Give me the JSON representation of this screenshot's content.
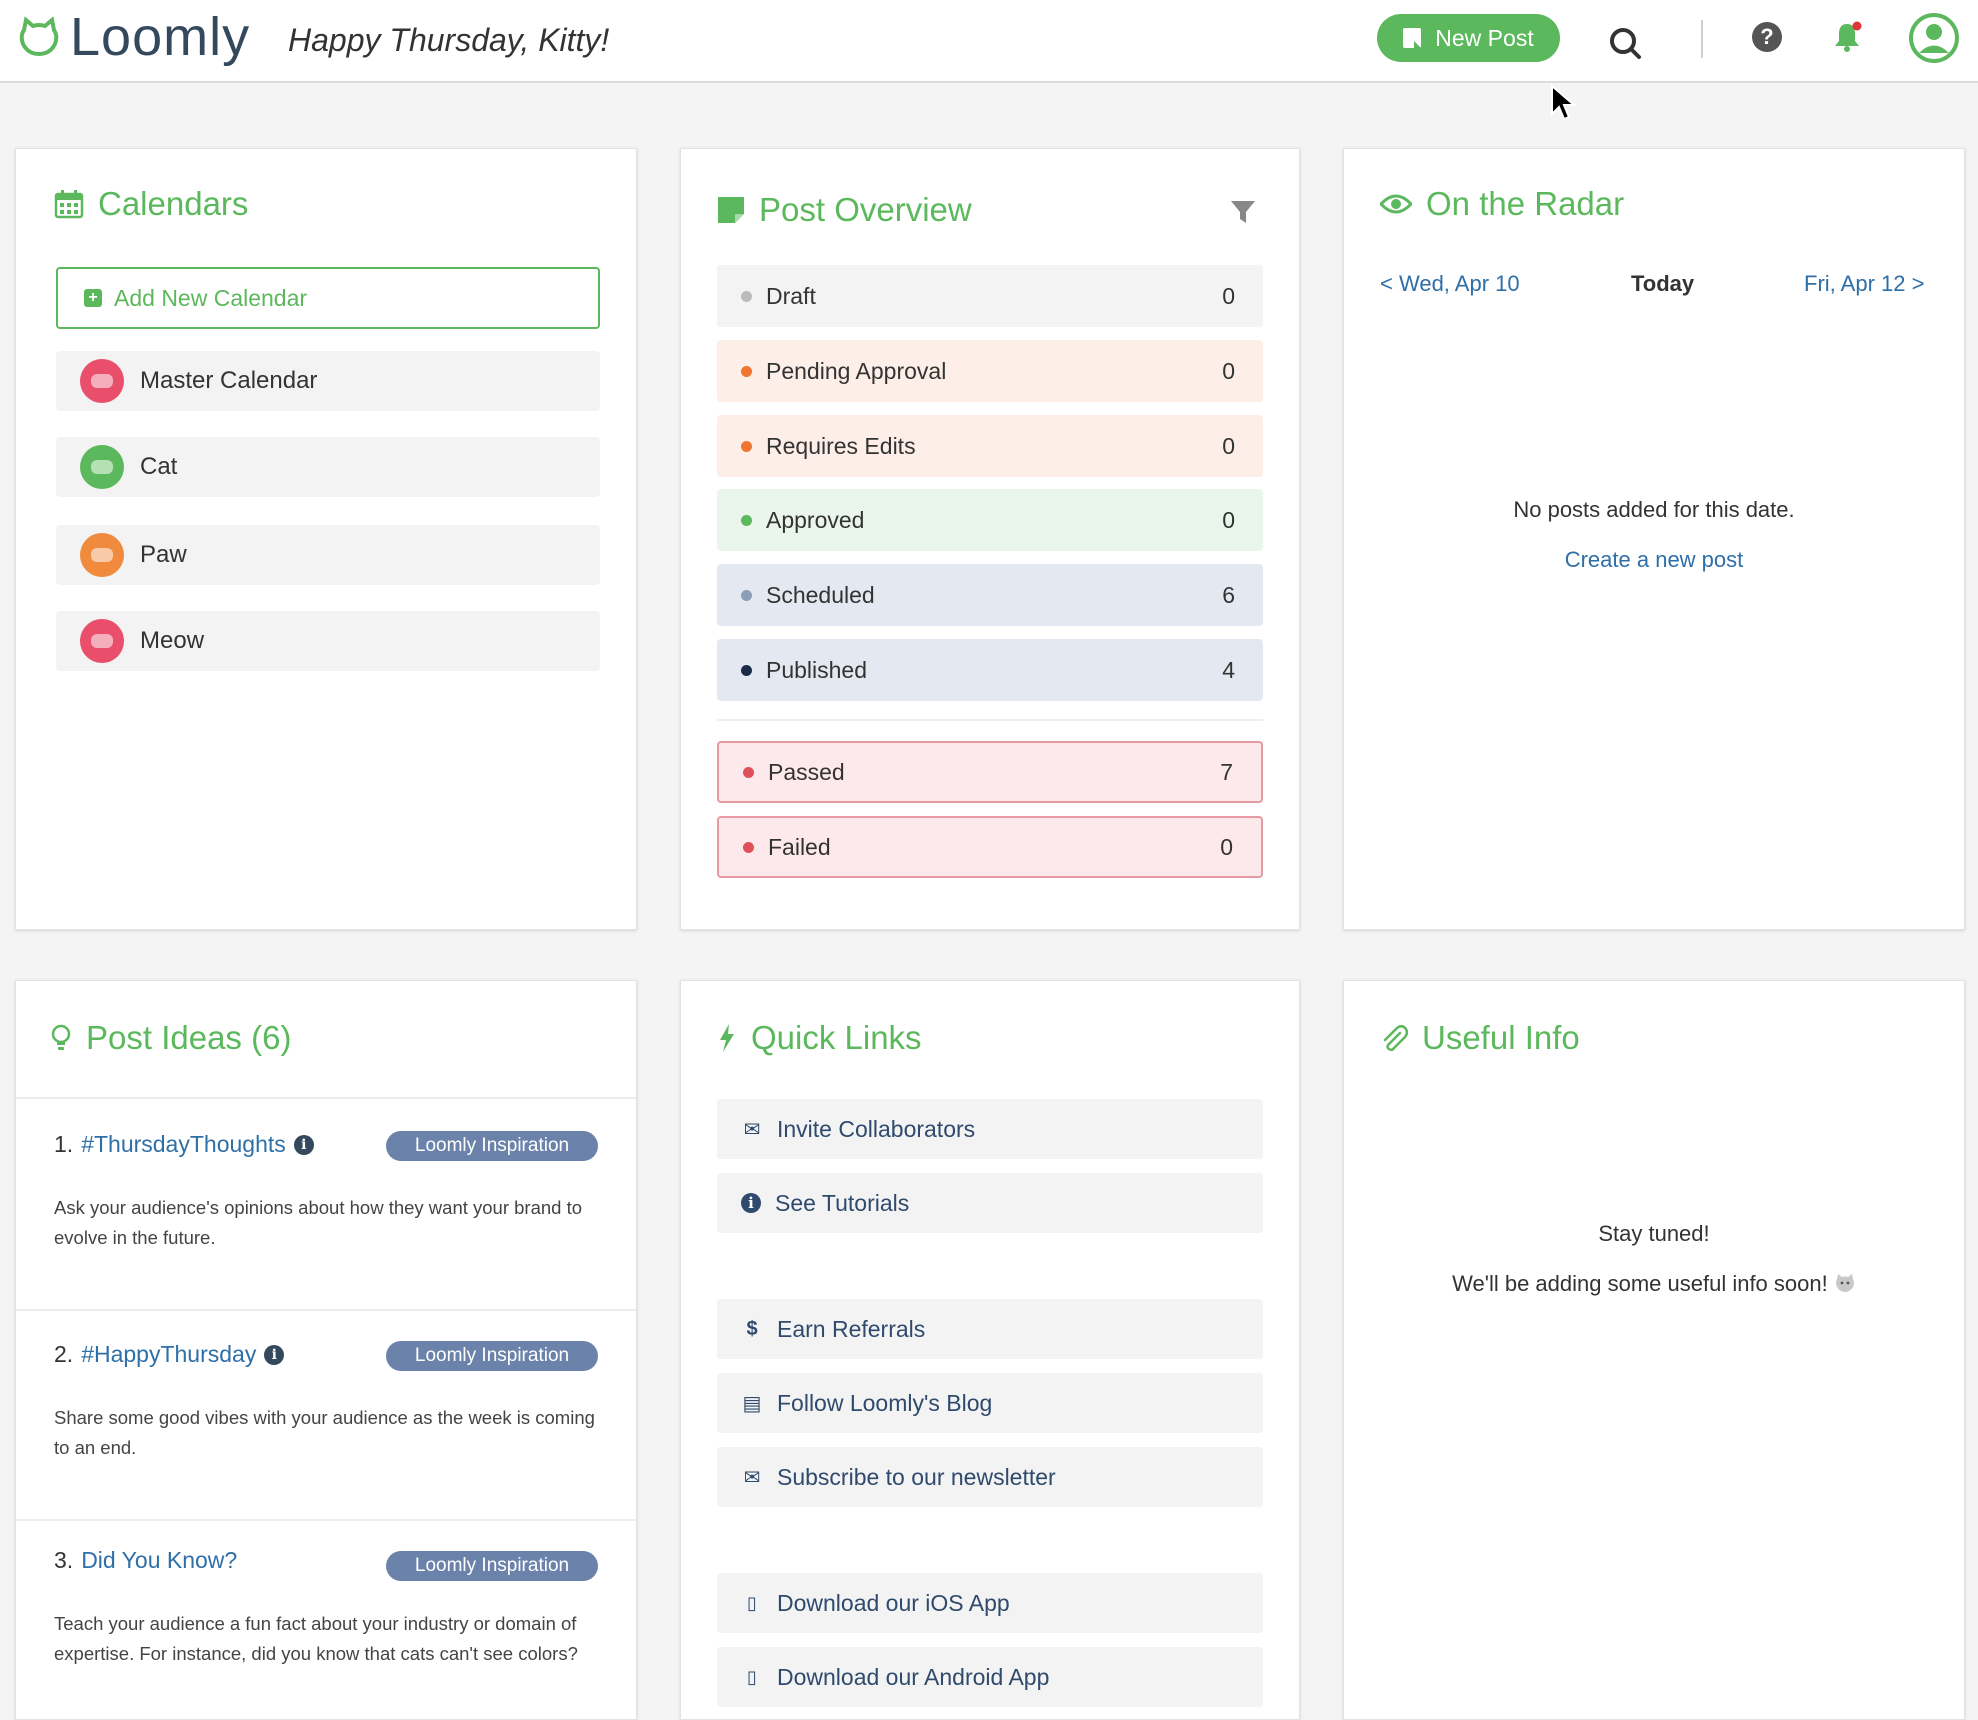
{
  "header": {
    "logo_text": "Loomly",
    "greeting": "Happy Thursday, Kitty!",
    "new_post_label": "New Post"
  },
  "calendars": {
    "title": "Calendars",
    "add_label": "Add New Calendar",
    "items": [
      {
        "label": "Master Calendar",
        "color": "#e94f6a"
      },
      {
        "label": "Cat",
        "color": "#5cb85c"
      },
      {
        "label": "Paw",
        "color": "#f08a3c"
      },
      {
        "label": "Meow",
        "color": "#e94f6a"
      }
    ]
  },
  "post_overview": {
    "title": "Post Overview",
    "statuses": [
      {
        "label": "Draft",
        "count": "0",
        "bg": "#f3f3f3",
        "dot": "#bbbbbb"
      },
      {
        "label": "Pending Approval",
        "count": "0",
        "bg": "#fdeee8",
        "dot": "#f0752e"
      },
      {
        "label": "Requires Edits",
        "count": "0",
        "bg": "#fdeee8",
        "dot": "#f0752e"
      },
      {
        "label": "Approved",
        "count": "0",
        "bg": "#eaf6ec",
        "dot": "#5cb85c"
      },
      {
        "label": "Scheduled",
        "count": "6",
        "bg": "#e4e9f1",
        "dot": "#8c9db8"
      },
      {
        "label": "Published",
        "count": "4",
        "bg": "#e4e9f1",
        "dot": "#1b2c48"
      }
    ],
    "alerts": [
      {
        "label": "Passed",
        "count": "7",
        "bg": "#fde9ec",
        "dot": "#e0505a",
        "border": "#e89aa3"
      },
      {
        "label": "Failed",
        "count": "0",
        "bg": "#fde9ec",
        "dot": "#e0505a",
        "border": "#e89aa3"
      }
    ]
  },
  "radar": {
    "title": "On the Radar",
    "prev": "< Wed, Apr 10",
    "today": "Today",
    "next": "Fri, Apr 12 >",
    "empty": "No posts added for this date.",
    "create_link": "Create a new post"
  },
  "post_ideas": {
    "title": "Post Ideas (6)",
    "ideas": [
      {
        "num": "1.",
        "title": "#ThursdayThoughts",
        "badge": "Loomly Inspiration",
        "desc": "Ask your audience's opinions about how they want your brand to evolve in the future."
      },
      {
        "num": "2.",
        "title": "#HappyThursday",
        "badge": "Loomly Inspiration",
        "desc": "Share some good vibes with your audience as the week is coming to an end."
      },
      {
        "num": "3.",
        "title": "Did You Know?",
        "badge": "Loomly Inspiration",
        "desc": "Teach your audience a fun fact about your industry or domain of expertise. For instance, did you know that cats can't see colors?"
      }
    ]
  },
  "quick_links": {
    "title": "Quick Links",
    "links": [
      {
        "label": "Invite Collaborators",
        "icon": "envelope-icon"
      },
      {
        "label": "See Tutorials",
        "icon": "info-icon"
      },
      {
        "label": "Earn Referrals",
        "icon": "dollar-icon"
      },
      {
        "label": "Follow Loomly's Blog",
        "icon": "newspaper-icon"
      },
      {
        "label": "Subscribe to our newsletter",
        "icon": "envelope-outline-icon"
      },
      {
        "label": "Download our iOS App",
        "icon": "mobile-icon"
      },
      {
        "label": "Download our Android App",
        "icon": "mobile-icon"
      }
    ]
  },
  "useful_info": {
    "title": "Useful Info",
    "line1": "Stay tuned!",
    "line2": "We'll be adding some useful info soon!"
  },
  "colors": {
    "brand_green": "#5cb85c",
    "link_blue": "#2f6fa8",
    "badge": "#6b83aa"
  }
}
